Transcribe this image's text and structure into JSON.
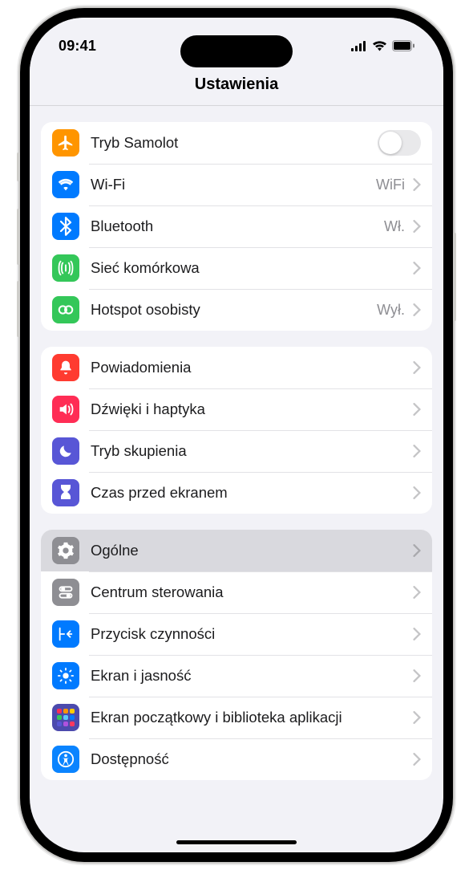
{
  "status": {
    "time": "09:41"
  },
  "header": {
    "title": "Ustawienia"
  },
  "sections": {
    "s0": {
      "airplane": {
        "label": "Tryb Samolot"
      },
      "wifi": {
        "label": "Wi-Fi",
        "value": "WiFi"
      },
      "bluetooth": {
        "label": "Bluetooth",
        "value": "Wł."
      },
      "cellular": {
        "label": "Sieć komórkowa"
      },
      "hotspot": {
        "label": "Hotspot osobisty",
        "value": "Wył."
      }
    },
    "s1": {
      "notifications": {
        "label": "Powiadomienia"
      },
      "sounds": {
        "label": "Dźwięki i haptyka"
      },
      "focus": {
        "label": "Tryb skupienia"
      },
      "screentime": {
        "label": "Czas przed ekranem"
      }
    },
    "s2": {
      "general": {
        "label": "Ogólne"
      },
      "control_center": {
        "label": "Centrum sterowania"
      },
      "action_button": {
        "label": "Przycisk czynności"
      },
      "display": {
        "label": "Ekran i jasność"
      },
      "home": {
        "label": "Ekran początkowy i biblioteka aplikacji"
      },
      "accessibility": {
        "label": "Dostępność"
      }
    }
  },
  "colors": {
    "orange": "#ff9500",
    "blue": "#007aff",
    "green": "#34c759",
    "red_notif": "#ff3b30",
    "pink": "#ff2d55",
    "indigo": "#5856d6",
    "gray": "#8e8e93",
    "accessibility_blue": "#0a84ff"
  }
}
